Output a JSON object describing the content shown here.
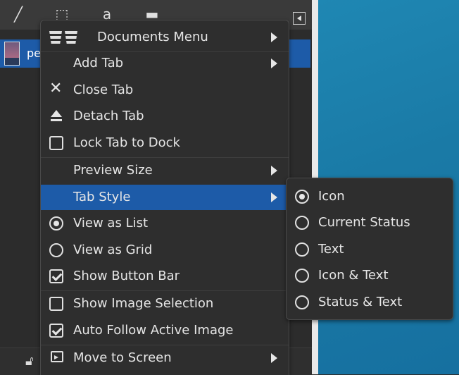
{
  "dock": {
    "tabs": [
      {
        "icon": "paintbrush-icon"
      },
      {
        "icon": "selection-icon"
      },
      {
        "icon": "text-icon"
      },
      {
        "icon": "documents-icon"
      }
    ],
    "list_item_label": "pe"
  },
  "main_menu": {
    "items": [
      {
        "label": "Documents Menu",
        "icon": "documents-icon",
        "submenu": true
      },
      {
        "label": "Add Tab",
        "submenu": true
      },
      {
        "label": "Close Tab",
        "icon": "close-icon"
      },
      {
        "label": "Detach Tab",
        "icon": "eject-icon"
      },
      {
        "label": "Lock Tab to Dock",
        "checkbox": false
      },
      {
        "label": "Preview Size",
        "submenu": true
      },
      {
        "label": "Tab Style",
        "submenu": true,
        "highlighted": true
      },
      {
        "label": "View as List",
        "radio": true
      },
      {
        "label": "View as Grid",
        "radio": false
      },
      {
        "label": "Show Button Bar",
        "checkbox": true
      },
      {
        "label": "Show Image Selection",
        "checkbox": false
      },
      {
        "label": "Auto Follow Active Image",
        "checkbox": true
      },
      {
        "label": "Move to Screen",
        "icon": "move-to-screen-icon",
        "submenu": true
      }
    ]
  },
  "tab_style_menu": {
    "items": [
      {
        "label": "Icon",
        "selected": true
      },
      {
        "label": "Current Status",
        "selected": false
      },
      {
        "label": "Text",
        "selected": false
      },
      {
        "label": "Icon & Text",
        "selected": false
      },
      {
        "label": "Status & Text",
        "selected": false
      }
    ]
  },
  "colors": {
    "highlight": "#1d5ba8",
    "menu_bg": "#2e2e2e",
    "desktop": "#1a7aa6"
  }
}
